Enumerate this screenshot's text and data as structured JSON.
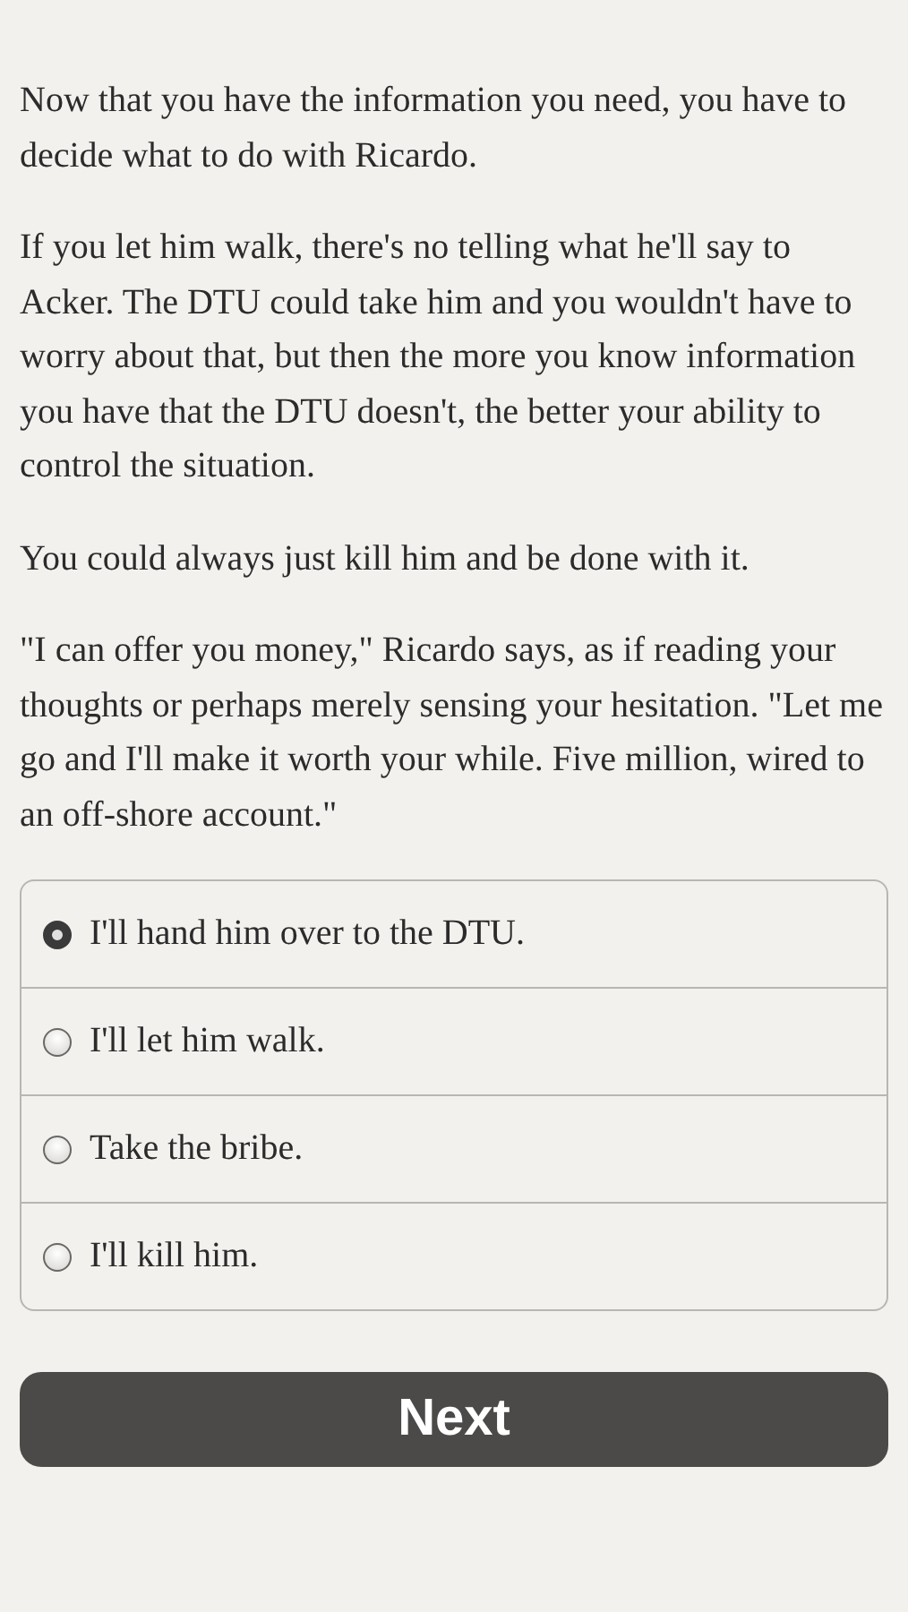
{
  "paragraphs": [
    "Now that you have the information you need, you have to decide what to do with Ricardo.",
    "If you let him walk, there's no telling what he'll say to Acker. The DTU could take him and you wouldn't have to worry about that, but then the more you know information you have that the DTU doesn't, the better your ability to control the situation.",
    "You could always just kill him and be done with it.",
    "\"I can offer you money,\" Ricardo says, as if reading your thoughts or perhaps merely sensing your hesitation. \"Let me go and I'll make it worth your while. Five million, wired to an off-shore account.\""
  ],
  "choices": [
    {
      "label": "I'll hand him over to the DTU.",
      "selected": true
    },
    {
      "label": "I'll let him walk.",
      "selected": false
    },
    {
      "label": "Take the bribe.",
      "selected": false
    },
    {
      "label": "I'll kill him.",
      "selected": false
    }
  ],
  "next_button": "Next"
}
